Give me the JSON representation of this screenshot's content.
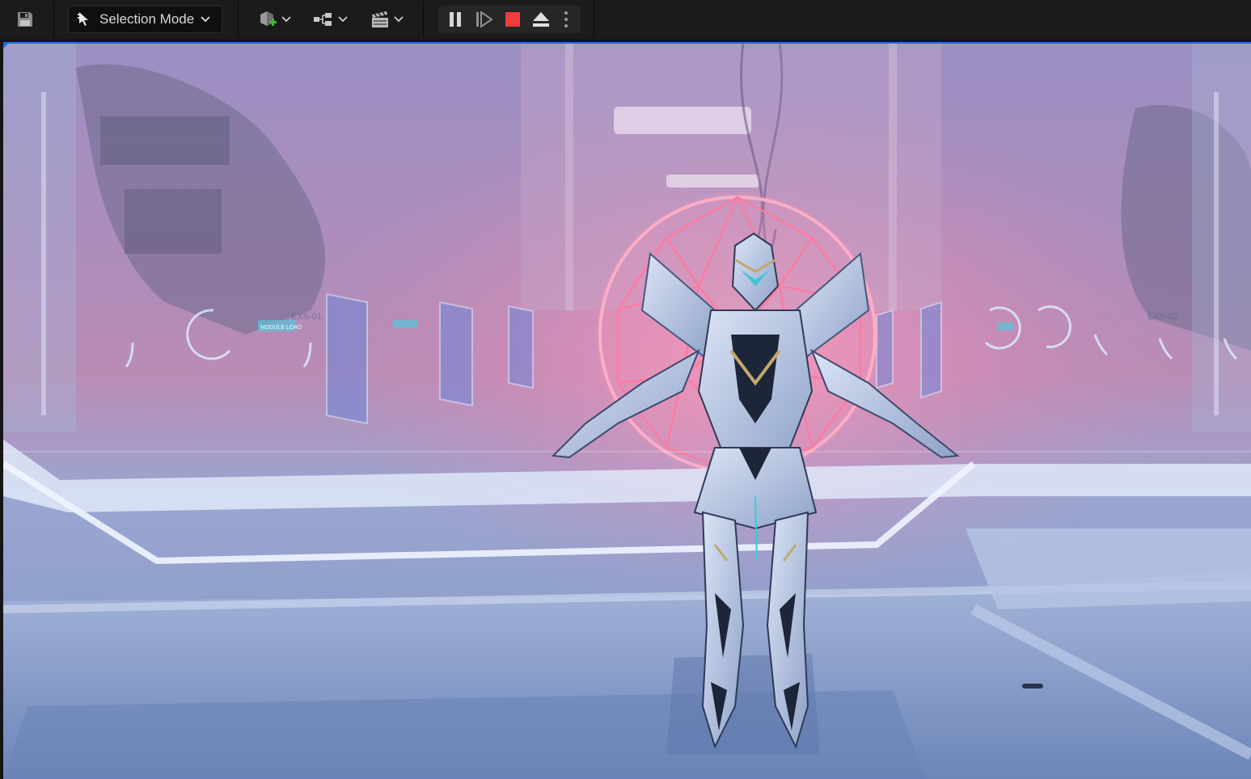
{
  "toolbar": {
    "save_icon": "save-icon",
    "mode_label": "Selection Mode",
    "mode_icon": "cursor-selection-icon",
    "add_actor_icon": "add-actor-icon",
    "blueprint_icon": "blueprint-icon",
    "cinematics_icon": "clapperboard-icon",
    "play_controls": {
      "pause_icon": "pause-icon",
      "step_icon": "step-forward-icon",
      "stop_icon": "stop-icon",
      "eject_icon": "eject-icon",
      "options_icon": "more-options-icon"
    }
  },
  "viewport": {
    "sign_left": "EXS-01",
    "sign_right": "EXS-02",
    "holo_text": "MODULE LOAD"
  },
  "colors": {
    "toolbar_bg": "#1b1b1b",
    "accent_blue": "#1a6ed8",
    "stop_red": "#f03c3c",
    "sphere_pink": "#ff7aa0"
  }
}
